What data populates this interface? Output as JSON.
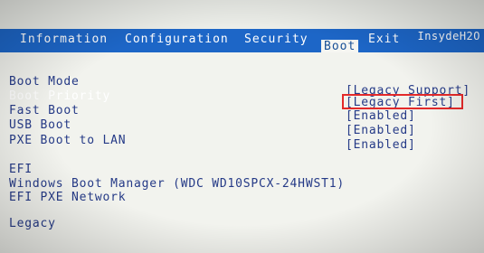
{
  "vendor": "InsydeH2O",
  "menu": {
    "tabs": [
      "Information",
      "Configuration",
      "Security",
      "Boot",
      "Exit"
    ],
    "active": "Boot"
  },
  "settings": [
    {
      "label": "Boot Mode",
      "value": "[Legacy Support]"
    },
    {
      "label": "Boot Priority",
      "value": "[Legacy First]"
    },
    {
      "label": "Fast Boot",
      "value": "[Enabled]"
    },
    {
      "label": "USB Boot",
      "value": "[Enabled]"
    },
    {
      "label": "PXE Boot to LAN",
      "value": "[Enabled]"
    }
  ],
  "efi": {
    "header": "EFI",
    "items": [
      "Windows Boot Manager (WDC WD10SPCX-24HWST1)",
      "EFI PXE Network"
    ]
  },
  "legacy": {
    "header": "Legacy"
  },
  "colors": {
    "menubar": "#1d66c7",
    "text": "#253a87",
    "highlight": "#e32a2a"
  }
}
